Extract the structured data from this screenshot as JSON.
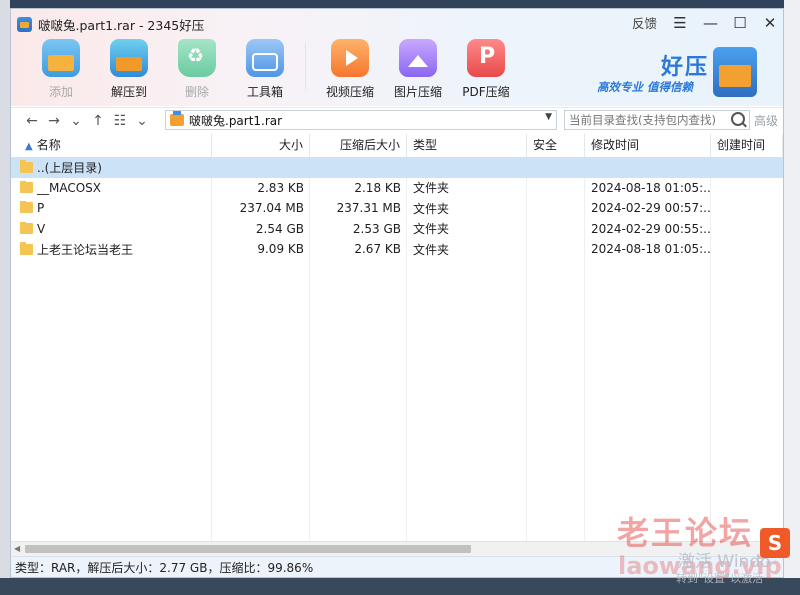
{
  "window": {
    "title": "啵啵兔.part1.rar - 2345好压",
    "feedback_label": "反馈",
    "menu_glyph": "☰",
    "minimize_glyph": "—",
    "maximize_glyph": "☐",
    "close_glyph": "✕"
  },
  "toolbar": {
    "items": [
      {
        "label": "添加",
        "icon": "add-archive-icon",
        "enabled": false
      },
      {
        "label": "解压到",
        "icon": "extract-icon",
        "enabled": true
      },
      {
        "label": "删除",
        "icon": "recycle-icon",
        "enabled": false
      },
      {
        "label": "工具箱",
        "icon": "toolbox-icon",
        "enabled": true
      },
      {
        "label": "视频压缩",
        "icon": "video-compress-icon",
        "enabled": true
      },
      {
        "label": "图片压缩",
        "icon": "image-compress-icon",
        "enabled": true
      },
      {
        "label": "PDF压缩",
        "icon": "pdf-compress-icon",
        "enabled": true
      }
    ]
  },
  "brand": {
    "name": "好压",
    "slogan": "高效专业  值得信赖"
  },
  "navbar": {
    "back_glyph": "←",
    "forward_glyph": "→",
    "history_glyph": "⌄",
    "up_glyph": "↑",
    "view_glyph": "☷",
    "view_drop_glyph": "⌄",
    "path": "啵啵兔.part1.rar",
    "path_drop_glyph": "▼",
    "search_placeholder": "当前目录查找(支持包内查找)",
    "advanced_label": "高级"
  },
  "table": {
    "sort_glyph": "▲",
    "columns": [
      "名称",
      "大小",
      "压缩后大小",
      "类型",
      "安全",
      "修改时间",
      "创建时间"
    ],
    "rows": [
      {
        "name": "..(上层目录)",
        "size": "",
        "packed": "",
        "type": "",
        "security": "",
        "modified": "",
        "created": "",
        "selected": true
      },
      {
        "name": "__MACOSX",
        "size": "2.83 KB",
        "packed": "2.18 KB",
        "type": "文件夹",
        "security": "",
        "modified": "2024-08-18 01:05:...",
        "created": "",
        "selected": false
      },
      {
        "name": "P",
        "size": "237.04 MB",
        "packed": "237.31 MB",
        "type": "文件夹",
        "security": "",
        "modified": "2024-02-29 00:57:...",
        "created": "",
        "selected": false
      },
      {
        "name": "V",
        "size": "2.54 GB",
        "packed": "2.53 GB",
        "type": "文件夹",
        "security": "",
        "modified": "2024-02-29 00:55:...",
        "created": "",
        "selected": false
      },
      {
        "name": "上老王论坛当老王",
        "size": "9.09 KB",
        "packed": "2.67 KB",
        "type": "文件夹",
        "security": "",
        "modified": "2024-08-18 01:05:...",
        "created": "",
        "selected": false
      }
    ]
  },
  "scrollbar": {
    "left_glyph": "◀",
    "right_glyph": "▶"
  },
  "status": {
    "text": "类型：RAR，解压后大小：2.77 GB，压缩比：99.86%"
  },
  "overlay": {
    "watermark": "老王论坛",
    "watermark_url": "laowang.vip",
    "activate_title": "激活 Windo",
    "activate_sub": "转到\"设置\"以激活",
    "sougou_glyph": "S"
  }
}
